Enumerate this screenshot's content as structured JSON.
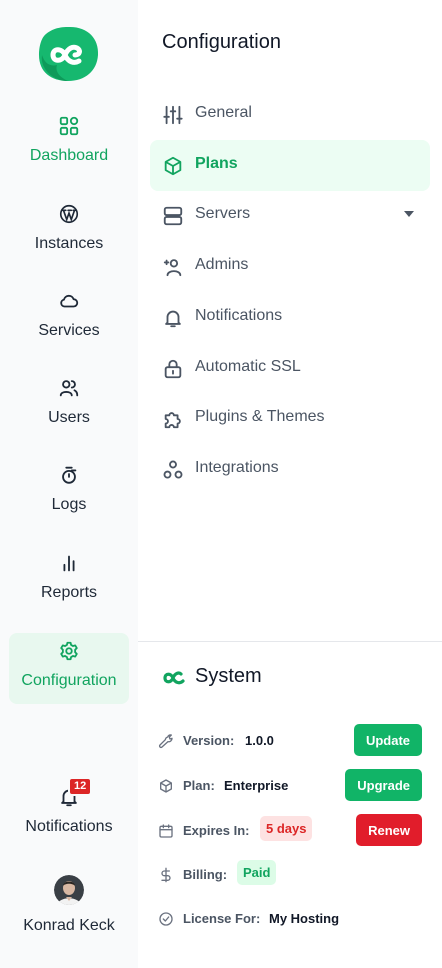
{
  "sidebar": {
    "items": [
      {
        "id": "dashboard",
        "label": "Dashboard",
        "icon": "dashboard-grid-icon",
        "active": true
      },
      {
        "id": "instances",
        "label": "Instances",
        "icon": "wordpress-icon",
        "active": false
      },
      {
        "id": "services",
        "label": "Services",
        "icon": "cloud-icon",
        "active": false
      },
      {
        "id": "users",
        "label": "Users",
        "icon": "users-icon",
        "active": false
      },
      {
        "id": "logs",
        "label": "Logs",
        "icon": "timer-icon",
        "active": false
      },
      {
        "id": "reports",
        "label": "Reports",
        "icon": "bar-chart-icon",
        "active": false
      },
      {
        "id": "configuration",
        "label": "Configuration",
        "icon": "gear-icon",
        "active": true
      },
      {
        "id": "notifications",
        "label": "Notifications",
        "icon": "bell-icon",
        "badge": "12"
      },
      {
        "id": "profile",
        "label": "Konrad Keck",
        "icon": "avatar"
      }
    ]
  },
  "config": {
    "title": "Configuration",
    "menu": [
      {
        "label": "General",
        "icon": "sliders-icon"
      },
      {
        "label": "Plans",
        "icon": "box-icon",
        "active": true
      },
      {
        "label": "Servers",
        "icon": "server-icon",
        "has_caret": true
      },
      {
        "label": "Admins",
        "icon": "user-plus-icon"
      },
      {
        "label": "Notifications",
        "icon": "bell-icon"
      },
      {
        "label": "Automatic SSL",
        "icon": "lock-icon"
      },
      {
        "label": "Plugins & Themes",
        "icon": "puzzle-icon"
      },
      {
        "label": "Integrations",
        "icon": "integrations-icon"
      }
    ]
  },
  "system": {
    "title": "System",
    "version_label": "Version:",
    "version_value": "1.0.0",
    "update_button": "Update",
    "plan_label": "Plan:",
    "plan_value": "Enterprise",
    "upgrade_button": "Upgrade",
    "expires_label": "Expires In:",
    "expires_value": "5 days",
    "renew_button": "Renew",
    "billing_label": "Billing:",
    "billing_value": "Paid",
    "license_label": "License For:",
    "license_value": "My Hosting"
  },
  "colors": {
    "accent": "#11a45f",
    "accent_bg": "#e8f8ef",
    "danger": "#e11d2b",
    "sidebar_bg": "#f9fafb"
  }
}
